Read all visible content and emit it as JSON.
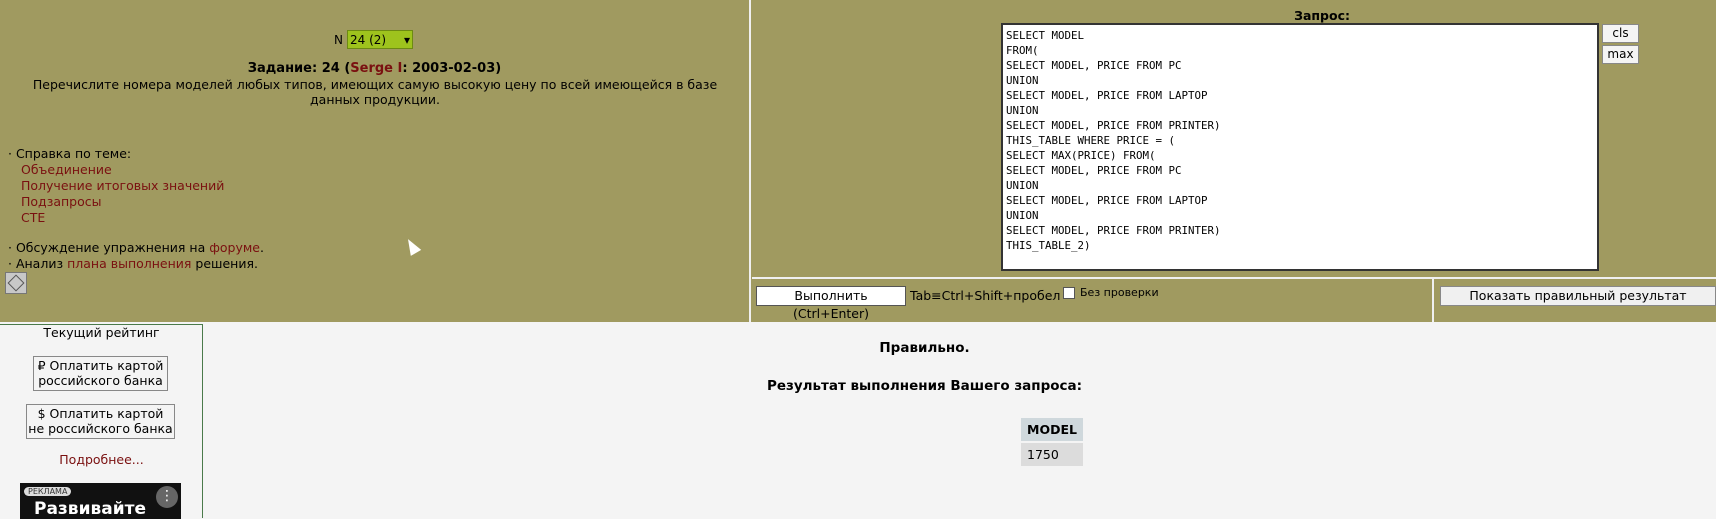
{
  "task": {
    "n_label": "N",
    "n_selected": "24 (2)",
    "title_prefix": "Задание: 24 (",
    "author": "Serge I",
    "title_suffix": ": 2003-02-03)",
    "description": "Перечислите номера моделей любых типов, имеющих самую высокую цену по всей имеющейся в базе данных продукции."
  },
  "help": {
    "heading": "· Справка по теме:",
    "links": [
      "Объединение",
      "Получение итоговых значений",
      "Подзапросы",
      "CTE"
    ]
  },
  "discussion": {
    "forum_prefix": "· Обсуждение упражнения на ",
    "forum_link": "форуме",
    "forum_suffix": ".",
    "plan_prefix": "· Анализ ",
    "plan_link": "плана выполнения",
    "plan_suffix": " решения."
  },
  "query": {
    "label": "Запрос:",
    "sql": "SELECT MODEL\nFROM(\nSELECT MODEL, PRICE FROM PC\nUNION\nSELECT MODEL, PRICE FROM LAPTOP\nUNION\nSELECT MODEL, PRICE FROM PRINTER)\nTHIS_TABLE WHERE PRICE = (\nSELECT MAX(PRICE) FROM(\nSELECT MODEL, PRICE FROM PC\nUNION\nSELECT MODEL, PRICE FROM LAPTOP\nUNION\nSELECT MODEL, PRICE FROM PRINTER)\nTHIS_TABLE_2)",
    "cls_label": "cls",
    "max_label": "max",
    "execute_label": "Выполнить (Ctrl+Enter)",
    "tab_hint": "Tab≡Ctrl+Shift+пробел",
    "nocheck_label": "Без  проверки",
    "show_result_label": "Показать правильный результат"
  },
  "sidebar": {
    "rating": "Текущий рейтинг",
    "pay_ru_line1": "₽ Оплатить картой",
    "pay_ru_line2": "российского банка",
    "pay_foreign_line1": "$ Оплатить картой",
    "pay_foreign_line2": "не российского банка",
    "more": "Подробнее...",
    "ad_tag": "РЕКЛАМА",
    "ad_text": "Развивайте"
  },
  "result": {
    "status": "Правильно.",
    "title": "Результат выполнения Вашего запроса:",
    "columns": [
      "MODEL"
    ],
    "rows": [
      [
        "1750"
      ]
    ]
  },
  "colors": {
    "panel_bg": "#a09a60",
    "link": "#7a1010",
    "select_bg": "#9ec31d"
  }
}
